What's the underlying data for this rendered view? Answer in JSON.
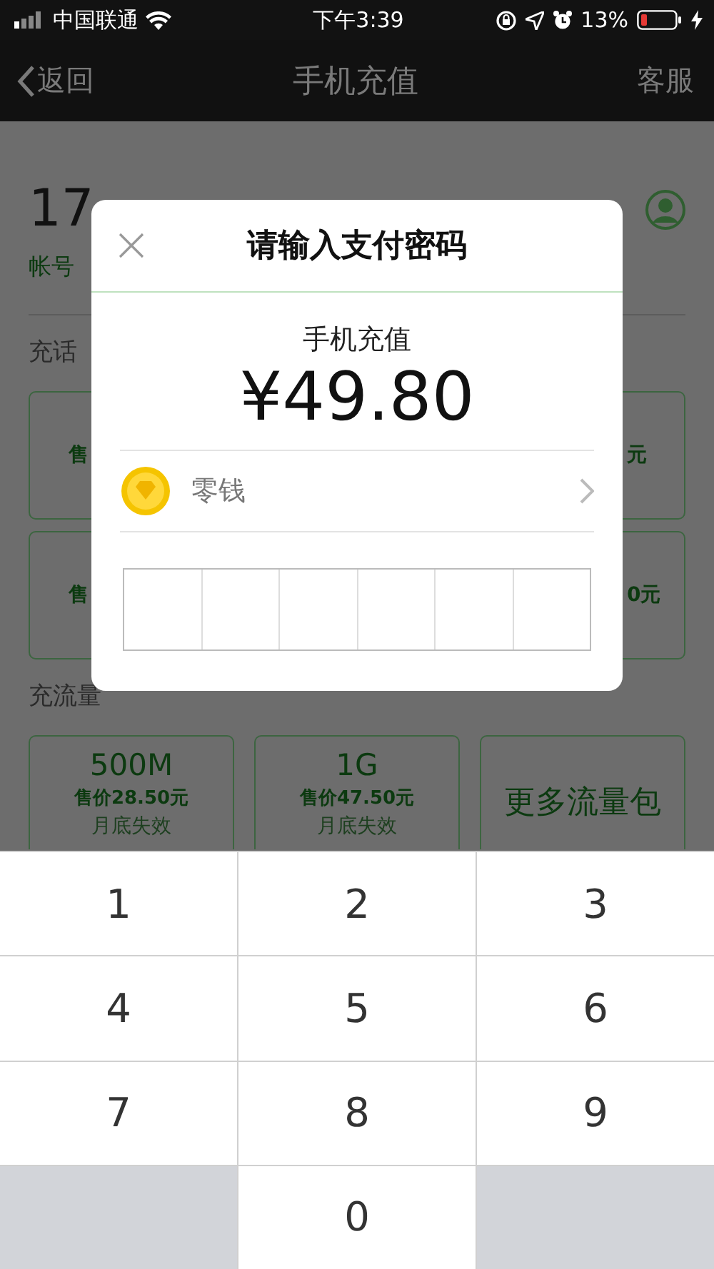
{
  "status_bar": {
    "carrier": "中国联通",
    "time": "下午3:39",
    "battery": "13%"
  },
  "nav": {
    "back": "返回",
    "title": "手机充值",
    "action": "客服"
  },
  "page": {
    "phone_number": "17",
    "account_label": "帐号",
    "topup_heading": "充话",
    "topup_cards": [
      {
        "kind": "left",
        "text": "售"
      },
      {
        "kind": "right",
        "text": "元"
      },
      {
        "kind": "left",
        "text": "售"
      },
      {
        "kind": "right",
        "text": "0元"
      }
    ],
    "data_heading": "充流量",
    "data_cards": [
      {
        "kind": "package",
        "size": "500M",
        "price": "售价28.50元",
        "note": "月底失效"
      },
      {
        "kind": "package",
        "size": "1G",
        "price": "售价47.50元",
        "note": "月底失效"
      },
      {
        "kind": "more",
        "label": "更多流量包"
      }
    ]
  },
  "dialog": {
    "title": "请输入支付密码",
    "item": "手机充值",
    "amount": "¥49.80",
    "method": "零钱",
    "pin_cells": [
      {
        "filled": false
      },
      {
        "filled": false
      },
      {
        "filled": false
      },
      {
        "filled": false
      },
      {
        "filled": false
      },
      {
        "filled": false
      }
    ]
  },
  "keypad": [
    {
      "kind": "digit",
      "label": "1"
    },
    {
      "kind": "digit",
      "label": "2"
    },
    {
      "kind": "digit",
      "label": "3"
    },
    {
      "kind": "digit",
      "label": "4"
    },
    {
      "kind": "digit",
      "label": "5"
    },
    {
      "kind": "digit",
      "label": "6"
    },
    {
      "kind": "digit",
      "label": "7"
    },
    {
      "kind": "digit",
      "label": "8"
    },
    {
      "kind": "digit",
      "label": "9"
    },
    {
      "kind": "blank"
    },
    {
      "kind": "digit",
      "label": "0"
    },
    {
      "kind": "blank"
    }
  ]
}
